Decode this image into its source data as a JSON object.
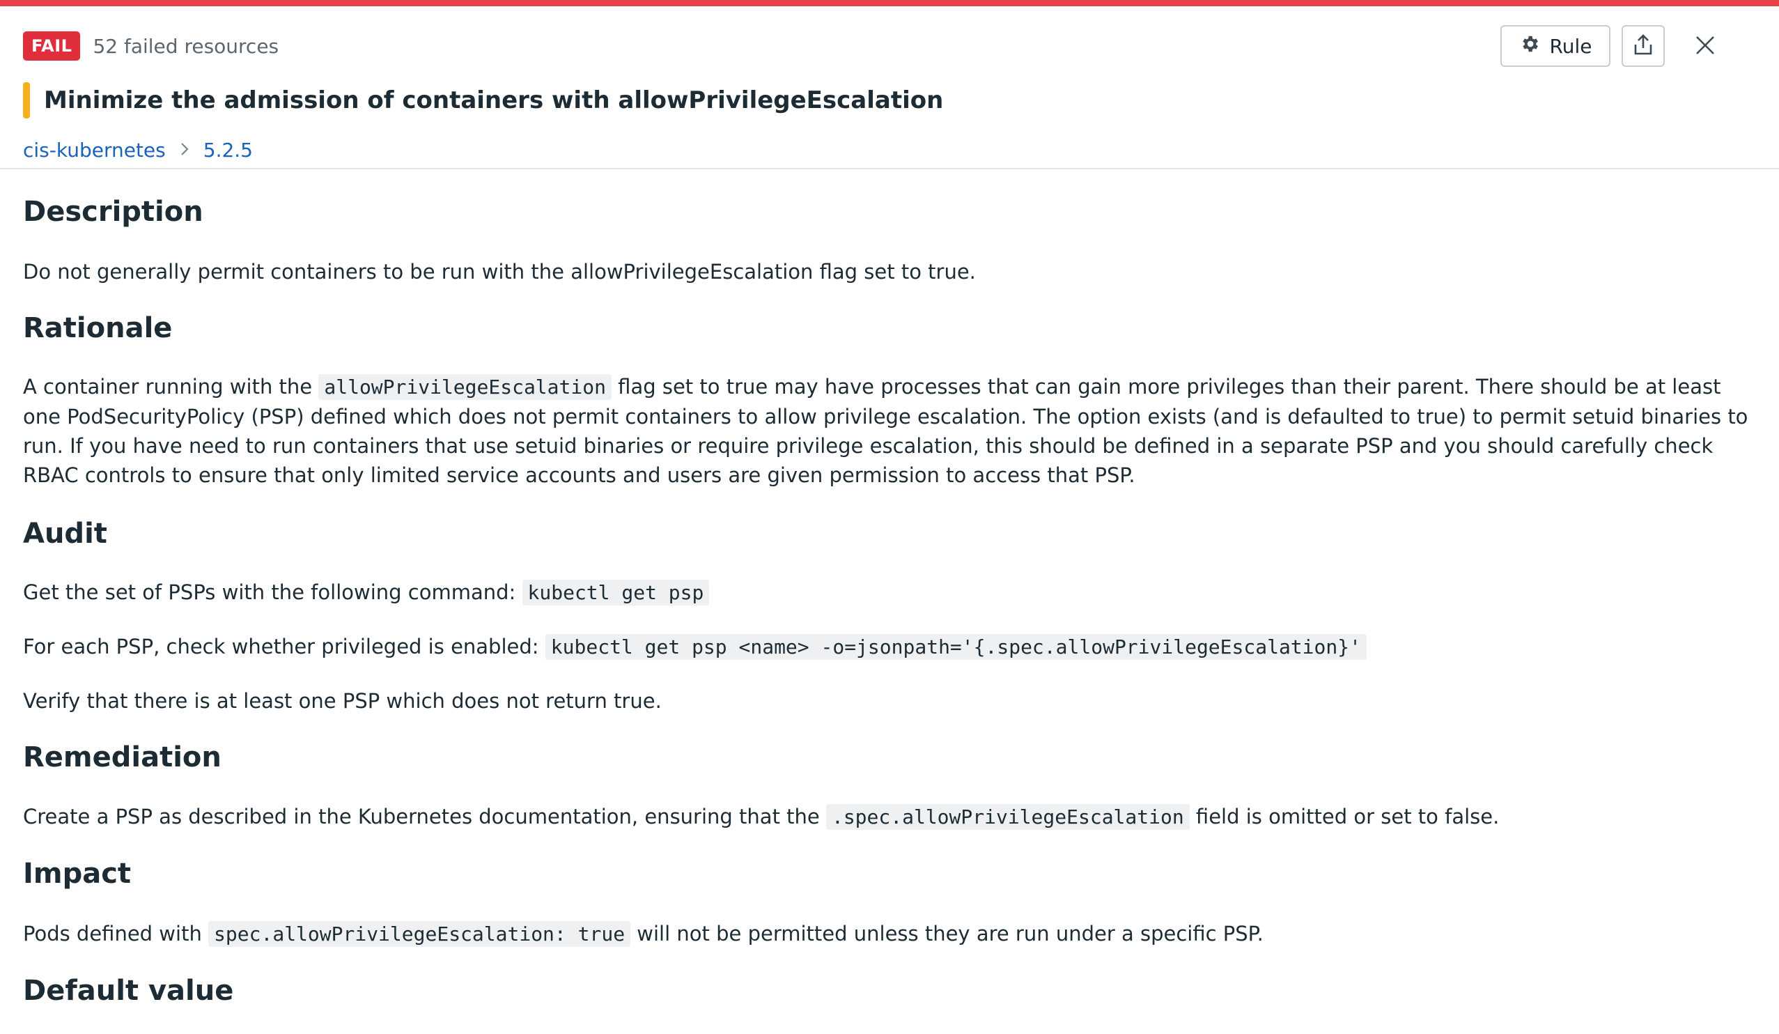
{
  "header": {
    "status_badge": "FAIL",
    "failed_count_text": "52 failed resources",
    "title": "Minimize the admission of containers with allowPrivilegeEscalation",
    "breadcrumb": [
      "cis-kubernetes",
      "5.2.5"
    ],
    "actions": {
      "rule_label": "Rule",
      "icons": [
        "gear-icon",
        "share-icon",
        "close-icon"
      ]
    }
  },
  "colors": {
    "accent_red": "#e8414a",
    "badge_red": "#e02e3d",
    "title_marker": "#f5b21c",
    "link": "#1a63b8"
  },
  "sections": {
    "description": {
      "heading": "Description",
      "text": "Do not generally permit containers to be run with the allowPrivilegeEscalation flag set to true."
    },
    "rationale": {
      "heading": "Rationale",
      "pre": "A container running with the",
      "code": "allowPrivilegeEscalation",
      "post": "flag set to true may have processes that can gain more privileges than their parent. There should be at least one PodSecurityPolicy (PSP) defined which does not permit containers to allow privilege escalation. The option exists (and is defaulted to true) to permit setuid binaries to run. If you have need to run containers that use setuid binaries or require privilege escalation, this should be defined in a separate PSP and you should carefully check RBAC controls to ensure that only limited service accounts and users are given permission to access that PSP."
    },
    "audit": {
      "heading": "Audit",
      "line1_text": "Get the set of PSPs with the following command:",
      "line1_code": "kubectl get psp",
      "line2_text": "For each PSP, check whether privileged is enabled:",
      "line2_code": "kubectl get psp <name> -o=jsonpath='{.spec.allowPrivilegeEscalation}'",
      "line3_text": "Verify that there is at least one PSP which does not return true."
    },
    "remediation": {
      "heading": "Remediation",
      "pre": "Create a PSP as described in the Kubernetes documentation, ensuring that the",
      "code": ".spec.allowPrivilegeEscalation",
      "post": "field is omitted or set to false."
    },
    "impact": {
      "heading": "Impact",
      "pre": "Pods defined with",
      "code": "spec.allowPrivilegeEscalation: true",
      "post": "will not be permitted unless they are run under a specific PSP."
    },
    "default_value": {
      "heading": "Default value"
    }
  }
}
